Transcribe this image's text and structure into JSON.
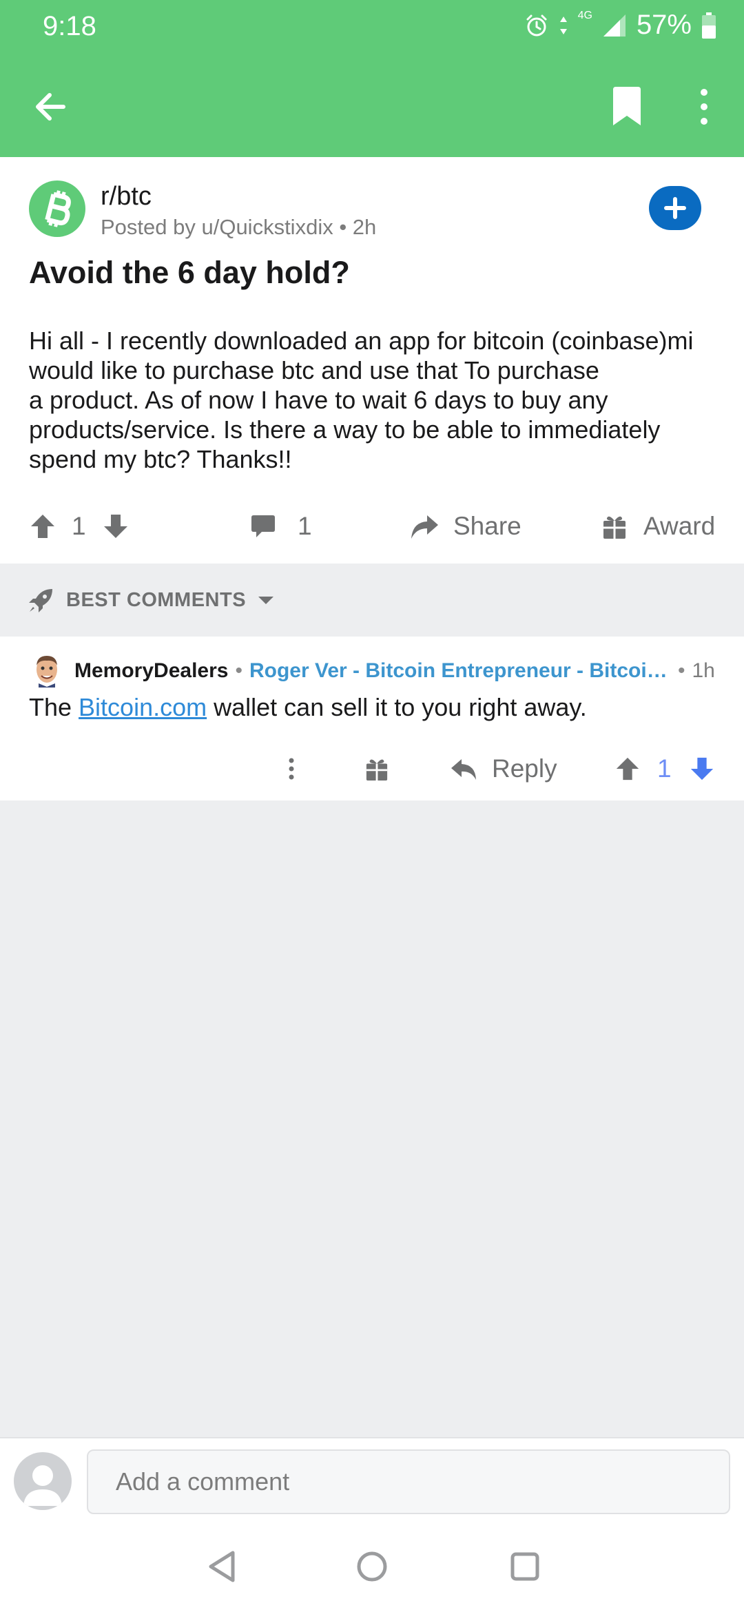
{
  "status_bar": {
    "time": "9:18",
    "network": "4G",
    "battery": "57%"
  },
  "toolbar": {
    "back_icon": "arrow-left-icon",
    "bookmark_icon": "bookmark-icon",
    "menu_icon": "more-vertical-icon"
  },
  "post": {
    "subreddit": "r/btc",
    "posted_by": "Posted by u/Quickstixdix",
    "age": "2h",
    "title": "Avoid the 6 day hold?",
    "body_lines": [
      "Hi all - I recently downloaded an app for bitcoin (coinbase)mi",
      "would like to purchase btc and use that To purchase",
      "a product. As of now I have to wait 6 days to buy any",
      "products/service. Is there a way to be able to immediately",
      "spend my btc? Thanks!!"
    ],
    "score": "1",
    "comment_count": "1",
    "share_label": "Share",
    "award_label": "Award"
  },
  "sort": {
    "label": "BEST COMMENTS"
  },
  "comment": {
    "author": "MemoryDealers",
    "flair": "Roger Ver - Bitcoin Entrepreneur - Bitcoin...",
    "age": "1h",
    "text_before": "The ",
    "link_text": "Bitcoin.com",
    "text_after": " wallet can sell it to you right away.",
    "reply_label": "Reply",
    "score": "1"
  },
  "compose": {
    "placeholder": "Add a comment"
  },
  "colors": {
    "header_green": "#5fcb78",
    "join_blue": "#0a6bc1",
    "flair_blue": "#3d95ce",
    "link_blue": "#2e8ad8",
    "vote_blue": "#6e8ef5"
  }
}
